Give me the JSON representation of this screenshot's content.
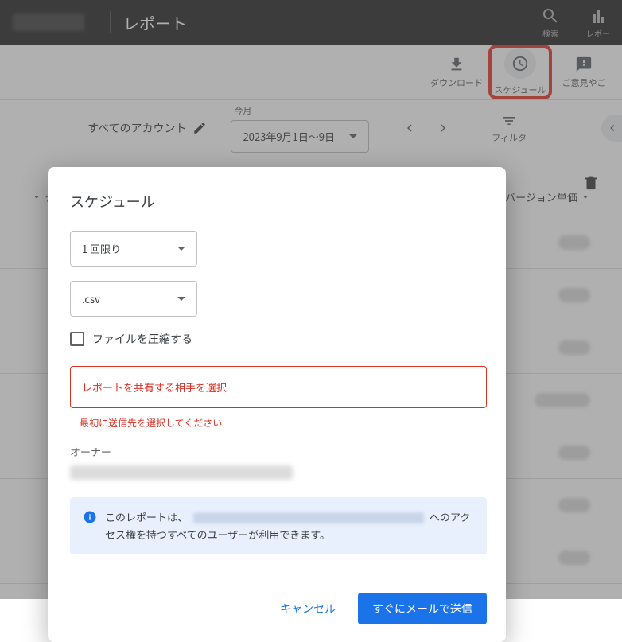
{
  "header": {
    "page_title": "レポート",
    "search_label": "検索",
    "report_label": "レポー"
  },
  "toolbar": {
    "download_label": "ダウンロード",
    "schedule_label": "スケジュール",
    "feedback_label": "ご意見やご"
  },
  "controls": {
    "account_label": "すべてのアカウント",
    "date_caption": "今月",
    "date_value": "2023年9月1日～9日",
    "filter_label": "フィルタ"
  },
  "table": {
    "col_left_prefix": "ク",
    "col_right": "バージョン単価"
  },
  "dialog": {
    "title": "スケジュール",
    "frequency": "1 回限り",
    "format": ".csv",
    "compress_label": "ファイルを圧縮する",
    "share_placeholder": "レポートを共有する相手を選択",
    "error_msg": "最初に送信先を選択してください",
    "owner_label": "オーナー",
    "info_prefix": "このレポートは、",
    "info_suffix": "へのアクセス権を持つすべてのユーザーが利用できます。",
    "cancel": "キャンセル",
    "submit": "すぐにメールで送信"
  }
}
